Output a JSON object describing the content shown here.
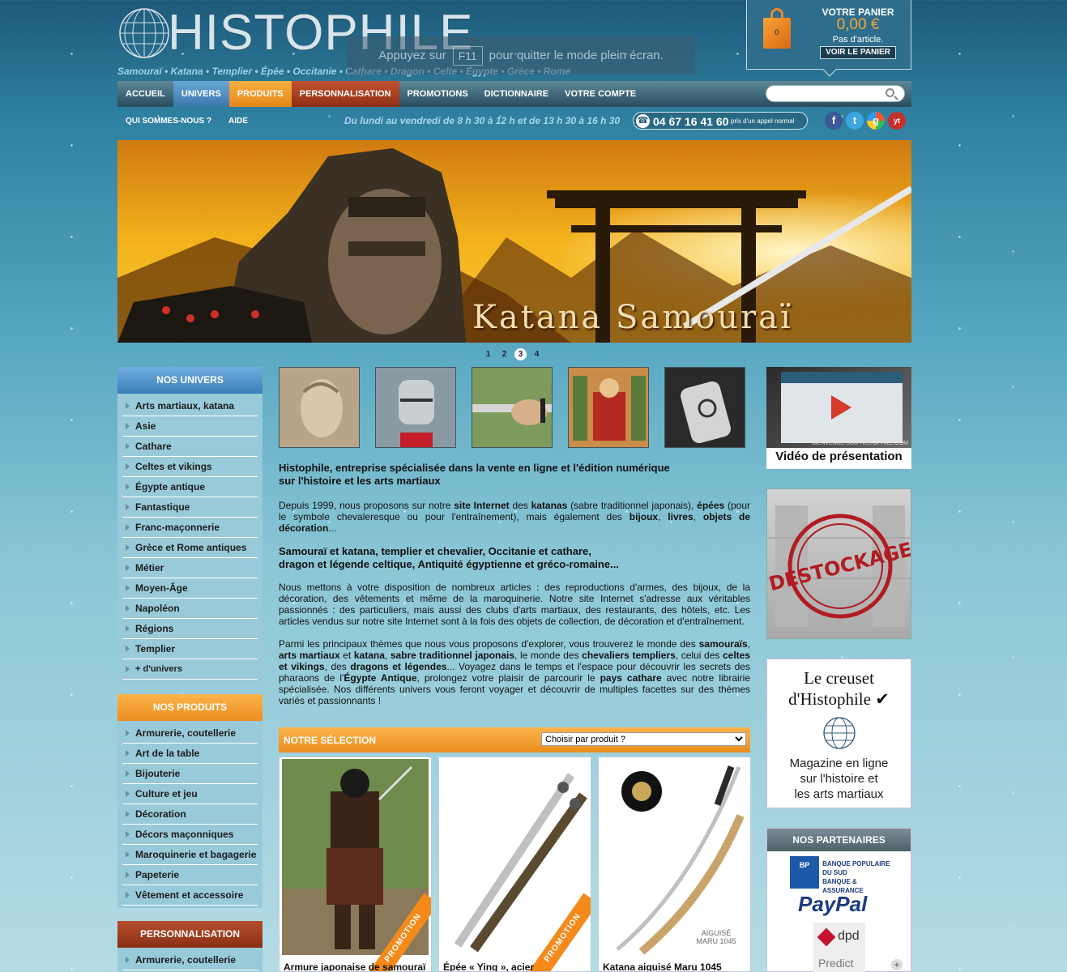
{
  "header": {
    "logo_text": "HISTOPHILE",
    "tagline": "Samouraï • Katana • Templier • Épée • Occitanie • Cathare • Dragon • Celte • Égypte • Grèce • Rome",
    "fullscreen_notice": {
      "before": "Appuyez sur",
      "key": "F11",
      "after": "pour quitter le mode plein écran."
    }
  },
  "cart": {
    "title": "VOTRE PANIER",
    "amount": "0,00 €",
    "status": "Pas d'article.",
    "count": "0",
    "button": "VOIR LE PANIER"
  },
  "nav": {
    "items": [
      {
        "label": "ACCUEIL"
      },
      {
        "label": "UNIVERS"
      },
      {
        "label": "PRODUITS"
      },
      {
        "label": "PERSONNALISATION"
      },
      {
        "label": "PROMOTIONS"
      },
      {
        "label": "DICTIONNAIRE"
      },
      {
        "label": "VOTRE COMPTE"
      }
    ],
    "search_placeholder": ""
  },
  "subnav": {
    "about": "QUI SOMMES-NOUS ?",
    "help": "AIDE",
    "hours": "Du lundi au vendredi de 8 h 30 à 12 h et de 13 h 30 à 16 h 30",
    "phone": "04 67 16 41 60",
    "phone_note": "prix d'un appel normal",
    "social": [
      "f",
      "t",
      "g",
      "yt"
    ]
  },
  "banner": {
    "caption": "Katana Samouraï",
    "pages": [
      "1",
      "2",
      "3",
      "4"
    ],
    "active_page": "3"
  },
  "sidebar": {
    "univers": {
      "title": "NOS UNIVERS",
      "items": [
        "Arts martiaux, katana",
        "Asie",
        "Cathare",
        "Celtes et vikings",
        "Égypte antique",
        "Fantastique",
        "Franc-maçonnerie",
        "Grèce et Rome antiques",
        "Métier",
        "Moyen-Âge",
        "Napoléon",
        "Régions",
        "Templier",
        "+ d'univers"
      ]
    },
    "produits": {
      "title": "NOS PRODUITS",
      "items": [
        "Armurerie, coutellerie",
        "Art de la table",
        "Bijouterie",
        "Culture et jeu",
        "Décoration",
        "Décors maçonniques",
        "Maroquinerie et bagagerie",
        "Papeterie",
        "Vêtement et accessoire"
      ]
    },
    "perso": {
      "title": "PERSONNALISATION",
      "items": [
        "Armurerie, coutellerie"
      ]
    }
  },
  "intro": {
    "heading1": "Histophile, entreprise spécialisée dans la vente en ligne et l'édition numérique",
    "heading1b": "sur l'histoire et les arts martiaux",
    "p1": {
      "a": "Depuis 1999, nous proposons sur notre ",
      "b": "site Internet",
      "c": " des ",
      "d": "katanas",
      "e": " (sabre traditionnel japonais), ",
      "f": "épées",
      "g": " (pour le symbole chevaleresque ou pour l'entraînement), mais également des ",
      "h": "bijoux",
      "i": ", ",
      "j": "livres",
      "k": ", ",
      "l": "objets de décoration",
      "m": "..."
    },
    "heading2": "Samouraï et katana, templier et chevalier, Occitanie et cathare,",
    "heading2b": "dragon et légende celtique, Antiquité égyptienne et gréco-romaine...",
    "p2": "Nous mettons à votre disposition de nombreux articles : des reproductions d'armes, des bijoux, de la décoration, des vêtements et même de la maroquinerie. Notre site Internet s'adresse aux véritables passionnés : des particuliers, mais aussi des clubs d'arts martiaux, des restaurants, des hôtels, etc. Les articles vendus sur notre site Internet sont à la fois des objets de collection, de décoration et d'entraînement.",
    "p3": {
      "a": "Parmi les principaux thèmes que nous vous proposons d'explorer, vous trouverez le monde des ",
      "b": "samouraïs",
      "c": ", ",
      "d": "arts martiaux",
      "e": " et ",
      "f": "katana",
      "g": ", ",
      "h": "sabre traditionnel japonais",
      "i": ", le monde des ",
      "j": "chevaliers templiers",
      "k": ", celui des ",
      "l": "celtes et vikings",
      "m": ", des ",
      "n": "dragons et légendes",
      "o": "... Voyagez dans le temps et l'espace pour découvrir les secrets des pharaons de l'",
      "p": "Égypte Antique",
      "q": ", prolongez votre plaisir de parcourir le ",
      "r": "pays cathare",
      "s": " avec notre librairie spécialisée. Nos différents univers vous feront voyager et découvrir de multiples facettes sur des thèmes variés et passionnants !"
    }
  },
  "selection": {
    "title": "NOTRE SÉLECTION",
    "select_value": "Choisir par produit ?",
    "products": [
      {
        "name": "Armure japonaise de samouraï",
        "badge": "PROMOTION"
      },
      {
        "name": "Épée « Ying », acier",
        "badge": "PROMOTION"
      },
      {
        "name": "Katana aiguisé Maru 1045",
        "badge": "",
        "img_text": "AIGUISÉ MARU 1045"
      }
    ]
  },
  "right": {
    "video_caption": "Vidéo de présentation",
    "video_screen_text": "BIENVENUE SUR HISTOPHILE.COM",
    "destock": "DESTOCKAGE",
    "creuset_line1": "Le creuset",
    "creuset_line2": "d'Histophile ✔",
    "creuset_sub1": "Magazine en ligne",
    "creuset_sub2": "sur l'histoire et",
    "creuset_sub3": "les arts martiaux",
    "partners_title": "NOS PARTENAIRES",
    "bp_line1": "BANQUE POPULAIRE",
    "bp_line2": "DU SUD",
    "bp_line3": "BANQUE & ASSURANCE",
    "paypal": "PayPal",
    "dpd": "dpd",
    "predict": "Predict"
  },
  "colors": {
    "accent_orange": "#ec8d1f",
    "accent_blue": "#3a7fb8",
    "accent_brown": "#8a2e14"
  }
}
